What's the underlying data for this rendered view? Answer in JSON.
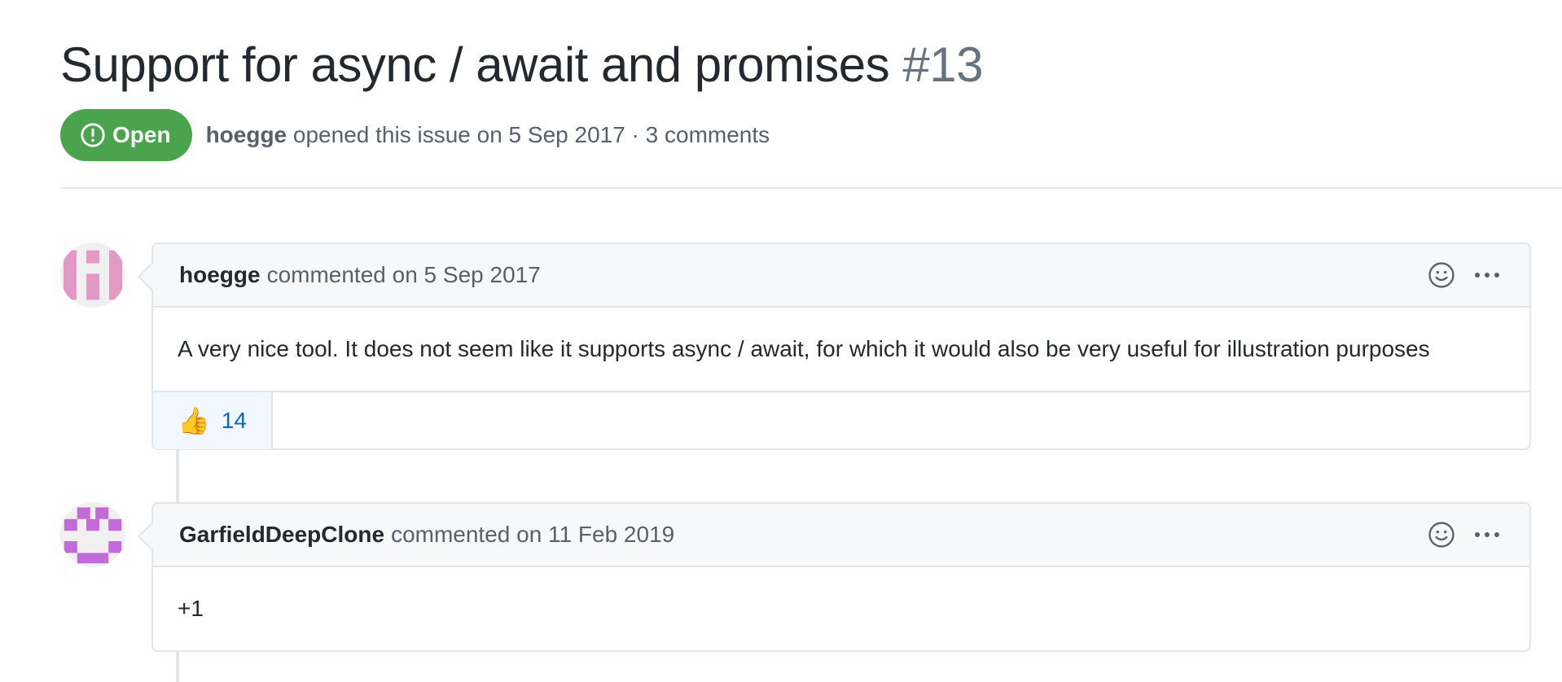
{
  "issue": {
    "title": "Support for async / await and promises",
    "number": "#13",
    "state": "Open",
    "author": "hoegge",
    "opened_text": "opened this issue on 5 Sep 2017 · 3 comments"
  },
  "colors": {
    "open_badge": "#4aa44e",
    "avatar_hoegge": "#e29ac4",
    "avatar_garfield": "#c16ad8",
    "reaction_bg": "#f1f8ff",
    "link_blue": "#0366d6"
  },
  "comments": [
    {
      "author": "hoegge",
      "meta": "commented on 5 Sep 2017",
      "body": "A very nice tool. It does not seem like it supports async / await, for which it would also be very useful for illustration purposes",
      "reactions": [
        {
          "emoji": "👍",
          "icon": "thumbs-up-icon",
          "count": "14"
        }
      ]
    },
    {
      "author": "GarfieldDeepClone",
      "meta": "commented on 11 Feb 2019",
      "body": "+1"
    }
  ],
  "icons": {
    "state": "issue-opened-icon",
    "add_reaction": "smiley-icon",
    "more": "kebab-horizontal-icon"
  }
}
